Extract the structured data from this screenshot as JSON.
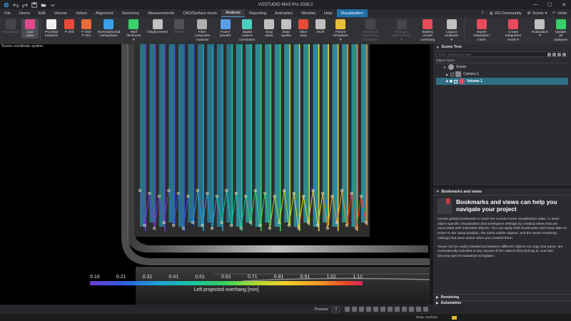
{
  "app": {
    "title": "VGSTUDIO MAX Pro 2026.2"
  },
  "window_controls": {
    "minimize": "—",
    "maximize": "☐",
    "close": "✕"
  },
  "menu": [
    {
      "label": "File"
    },
    {
      "label": "Home"
    },
    {
      "label": "Edit"
    },
    {
      "label": "Volume"
    },
    {
      "label": "Select"
    },
    {
      "label": "Alignment"
    },
    {
      "label": "Geometry"
    },
    {
      "label": "Measurements"
    },
    {
      "label": "CAD/Surface mesh"
    },
    {
      "label": "Analysis"
    },
    {
      "label": "Reporting"
    },
    {
      "label": "Animation"
    },
    {
      "label": "Window"
    },
    {
      "label": "Help"
    },
    {
      "label": "Visualization"
    }
  ],
  "menu_right": {
    "community": "VG Community",
    "scene": "Scene",
    "units": "Units"
  },
  "ribbon": [
    {
      "label": "Annotation",
      "color": "#6b6c70"
    },
    {
      "label": "Live\nvalue",
      "color": "#e04a8c"
    },
    {
      "label": "Porosity/\ninclusion",
      "color": "#f0f0f0"
    },
    {
      "label": "P 203",
      "color": "#e84a3a"
    },
    {
      "label": "P 202/\nP 201",
      "color": "#e86a3a"
    },
    {
      "label": "Nominal/actual\ncomparison",
      "color": "#3aa0e8"
    },
    {
      "label": "Wall\nthickness ▾",
      "color": "#3ad06a"
    },
    {
      "label": "Displacement",
      "color": "#c0c0c0"
    },
    {
      "label": "Defect",
      "color": "#8a8b8f"
    },
    {
      "label": "Fiber composite\nmaterial",
      "color": "#b0b0b0"
    },
    {
      "label": "Foam/\npowder",
      "color": "#5aa0e8"
    },
    {
      "label": "Digital volume\ncorrelation",
      "color": "#4ad0c0"
    },
    {
      "label": "Gray\nvalue",
      "color": "#c0c0c0"
    },
    {
      "label": "Data\nquality",
      "color": "#c0c0c0"
    },
    {
      "label": "Slice\narea",
      "color": "#e84a3a"
    },
    {
      "label": "OCR",
      "color": "#c0c0c0"
    },
    {
      "label": "Fixture\nsimulation ▾",
      "color": "#e8c03a"
    },
    {
      "label": "Structural mechanics\nsimulation",
      "color": "#6b6c70"
    },
    {
      "label": "Transport\nphenomena ▾",
      "color": "#6b6c70"
    },
    {
      "label": "Battery anode\noverhang",
      "color": "#e84a5a"
    },
    {
      "label": "Legacy\nanalyses ▾",
      "color": "#c0c0c0"
    },
    {
      "label": "Import integration\nmesh",
      "color": "#e84a5a"
    },
    {
      "label": "Create integration\nmesh ▾",
      "color": "#e84a5a"
    },
    {
      "label": "Evaluation\n▾",
      "color": "#c0c0c0"
    },
    {
      "label": "Update all\nanalyses",
      "color": "#3ad06a"
    }
  ],
  "viewport": {
    "label": "Scene coordinate system",
    "colorbar": {
      "ticks": [
        "0.10",
        "0.21",
        "0.31",
        "0.41",
        "0.51",
        "0.61",
        "0.71",
        "0.81",
        "0.91",
        "1.01",
        "1.12"
      ],
      "title": "Left projected overhang [mm]"
    }
  },
  "scene_tree": {
    "header": "Scene Tree",
    "search_placeholder": "Enter search text here",
    "column": "Object name",
    "items": [
      {
        "label": "Scene"
      },
      {
        "label": "Camera 1"
      },
      {
        "label": "Volume 1"
      }
    ]
  },
  "bookmarks": {
    "header": "Bookmarks and views",
    "title": "Bookmarks and views can help you navigate your project",
    "p1": "Create global bookmarks to store the current scene visualization state, or store object-specific visualization and workspace settings by creating views that are associated with individual objects. You can apply both bookmarks and views later to return to the same position, the same visible objects, and the same rendering settings that were active when you created them.",
    "p2": "Views can be easily transferred between different objects via copy and paste, are automatically included in any reports of the objects they belong to, and also become part of evaluation templates."
  },
  "panels": {
    "rendering": "Rendering",
    "automation": "Automation"
  },
  "bottombar": {
    "preview_label": "Preview:",
    "preview_value": "3"
  },
  "status": {
    "snap": "Snap: Surface"
  }
}
